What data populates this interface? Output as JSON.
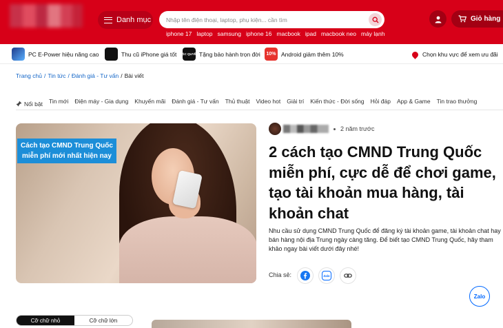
{
  "header": {
    "menu_label": "Danh mục",
    "search_placeholder": "Nhập tên điện thoại, laptop, phụ kiện... cần tìm",
    "suggestions": [
      "iphone 17",
      "laptop",
      "samsung",
      "iphone 16",
      "macbook",
      "ipad",
      "macbook neo",
      "máy lạnh"
    ],
    "cart_label": "Giỏ hàng",
    "brand_color": "#d70018"
  },
  "promo": {
    "items": [
      "PC E-Power hiệu năng cao",
      "Thu cũ iPhone giá tốt",
      "Tặng bảo hành trọn đời",
      "Android giảm thêm 10%"
    ],
    "badge_dq": "ĐẶC QUYỀN",
    "badge_10": "10%",
    "location": "Chọn khu vực để xem ưu đãi"
  },
  "breadcrumb": [
    "Trang chủ",
    "Tin tức",
    "Đánh giá - Tư vấn",
    "Bài viết"
  ],
  "categories": [
    "Nổi bật",
    "Tin mới",
    "Điện máy - Gia dụng",
    "Khuyến mãi",
    "Đánh giá - Tư vấn",
    "Thủ thuật",
    "Video hot",
    "Giải trí",
    "Kiến thức - Đời sống",
    "Hỏi đáp",
    "App & Game",
    "Tin trao thưởng"
  ],
  "article": {
    "hero_label_line1": "Cách tạo CMND Trung Quốc",
    "hero_label_line2": "miễn phí mới nhất hiện nay",
    "time_ago": "2 năm trước",
    "title": "2 cách tạo CMND Trung Quốc miễn phí, cực dễ để chơi game, tạo tài khoản mua hàng, tài khoản chat",
    "description": "Nhu cầu sử dụng CMND Trung Quốc để đăng ký tài khoản game, tài khoản chat hay bán hàng nội địa Trung ngày càng tăng. Để biết tạo CMND Trung Quốc, hãy tham khảo ngay bài viết dưới đây nhé!",
    "share_label": "Chia sẻ:",
    "zalo_share": "Zalo",
    "zalo_float": "Zalo"
  },
  "font_toggle": [
    "Cỡ chữ nhỏ",
    "Cỡ chữ lớn"
  ]
}
